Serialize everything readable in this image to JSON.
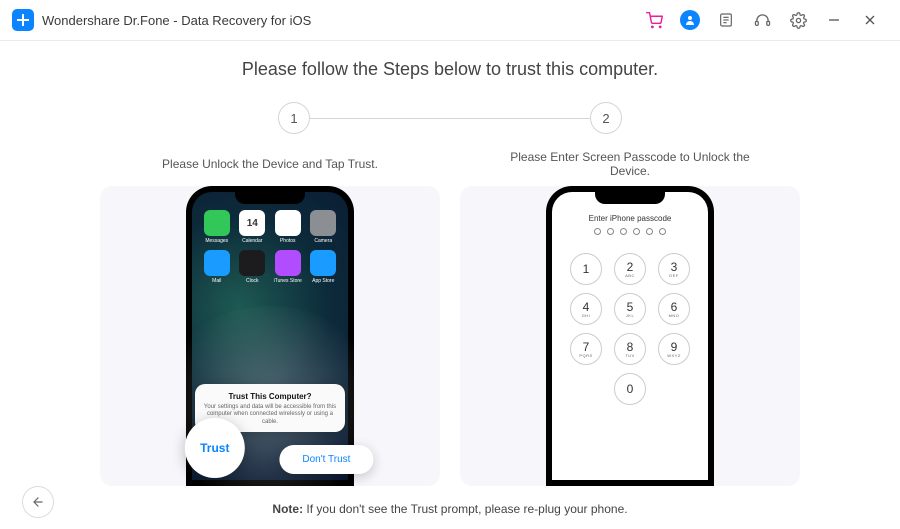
{
  "window": {
    "title": "Wondershare Dr.Fone - Data Recovery for iOS"
  },
  "heading": "Please follow the Steps below to trust this computer.",
  "steps": {
    "labels": [
      "1",
      "2"
    ],
    "captions": [
      "Please Unlock the Device and Tap Trust.",
      "Please Enter Screen Passcode to Unlock the Device."
    ]
  },
  "trust_dialog": {
    "title": "Trust This Computer?",
    "body": "Your settings and data will be accessible from this computer when connected wirelessly or using a cable.",
    "trust": "Trust",
    "dont_trust": "Don't Trust"
  },
  "apps": [
    {
      "label": "Messages",
      "bg": "#31c759"
    },
    {
      "label": "Calendar",
      "bg": "#ffffff",
      "text": "14"
    },
    {
      "label": "Photos",
      "bg": "#ffffff"
    },
    {
      "label": "Camera",
      "bg": "#8b8e93"
    },
    {
      "label": "Mail",
      "bg": "#1a9bff"
    },
    {
      "label": "Clock",
      "bg": "#1c1c1e"
    },
    {
      "label": "iTunes Store",
      "bg": "#b24cff"
    },
    {
      "label": "App Store",
      "bg": "#1a9bff"
    }
  ],
  "passcode": {
    "title": "Enter iPhone passcode",
    "keys": [
      {
        "n": "1",
        "l": ""
      },
      {
        "n": "2",
        "l": "ABC"
      },
      {
        "n": "3",
        "l": "DEF"
      },
      {
        "n": "4",
        "l": "GHI"
      },
      {
        "n": "5",
        "l": "JKL"
      },
      {
        "n": "6",
        "l": "MNO"
      },
      {
        "n": "7",
        "l": "PQRS"
      },
      {
        "n": "8",
        "l": "TUV"
      },
      {
        "n": "9",
        "l": "WXYZ"
      },
      {
        "n": "0",
        "l": ""
      }
    ]
  },
  "note": {
    "label": "Note:",
    "text": " If you don't see the Trust prompt, please re-plug your phone."
  }
}
